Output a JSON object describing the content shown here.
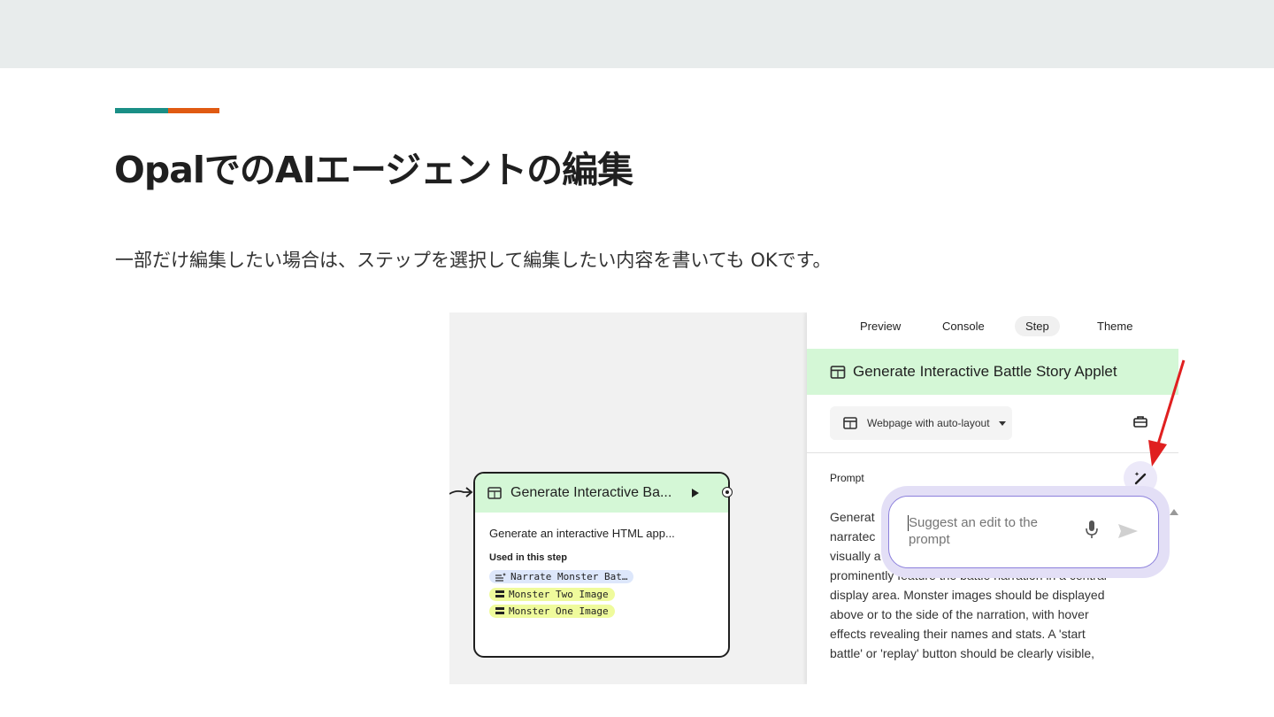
{
  "slide": {
    "title": "OpalでのAIエージェントの編集",
    "subtitle": "一部だけ編集したい場合は、ステップを選択して編集したい内容を書いても OKです。"
  },
  "colors": {
    "teal_accent": "#1a8f86",
    "orange_accent": "#e05a12",
    "node_header": "#d4f7d6",
    "chip_blue": "#dde7fb",
    "chip_yellow": "#effb9c",
    "suggest_border": "#8c80dc",
    "arrow_red": "#e02020"
  },
  "node": {
    "title": "Generate Interactive Ba...",
    "description": "Generate an interactive HTML app...",
    "used_label": "Used in this step",
    "chips": [
      {
        "label": "Narrate Monster Bat…",
        "icon": "text-spark-icon",
        "color": "blue"
      },
      {
        "label": "Monster Two Image",
        "icon": "equals-icon",
        "color": "yellow"
      },
      {
        "label": "Monster One Image",
        "icon": "equals-icon",
        "color": "yellow"
      }
    ]
  },
  "panel": {
    "tabs": [
      "Preview",
      "Console",
      "Step",
      "Theme"
    ],
    "active_tab": "Step",
    "step_title": "Generate Interactive Battle Story Applet",
    "output_select": "Webpage with auto-layout",
    "prompt_label": "Prompt",
    "prompt_text": [
      "Generat",
      "narratec",
      "visually a",
      "prominently feature the battle narration in a central",
      "display area. Monster images should be displayed",
      "above or to the side of the narration, with hover",
      "effects revealing their names and stats. A 'start",
      "battle' or 'replay' button should be clearly visible,"
    ],
    "suggest_placeholder": "Suggest an edit to the prompt"
  }
}
